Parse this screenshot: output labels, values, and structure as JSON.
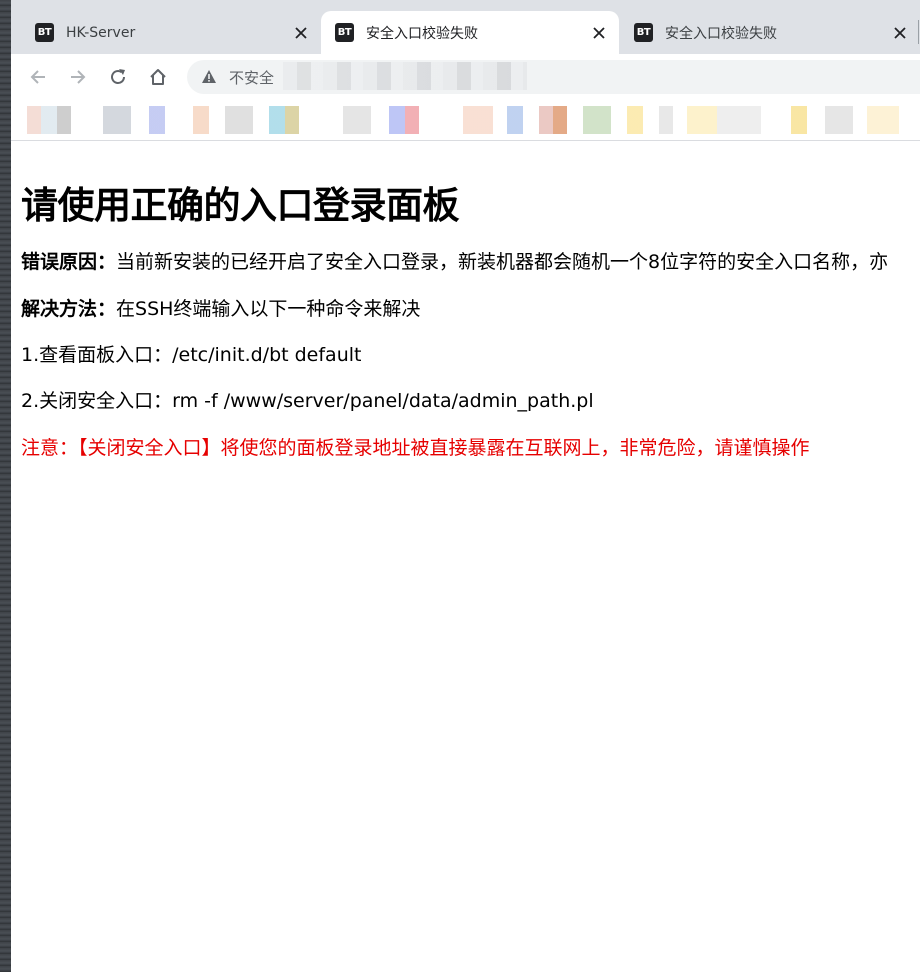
{
  "tabs": [
    {
      "favicon": "BT",
      "title": "HK-Server",
      "active": false
    },
    {
      "favicon": "BT",
      "title": "安全入口校验失败",
      "active": true
    },
    {
      "favicon": "BT",
      "title": "安全入口校验失败",
      "active": false
    }
  ],
  "toolbar": {
    "security_label": "不安全",
    "icons": [
      "back-icon",
      "forward-icon",
      "reload-icon",
      "home-icon",
      "warning-icon"
    ]
  },
  "page": {
    "heading": "请使用正确的入口登录面板",
    "reason_label": "错误原因：",
    "reason_text": "当前新安装的已经开启了安全入口登录，新装机器都会随机一个8位字符的安全入口名称，亦",
    "solution_label": "解决方法：",
    "solution_text": "在SSH终端输入以下一种命令来解决",
    "step1": "1.查看面板入口：/etc/init.d/bt default",
    "step2": "2.关闭安全入口：rm -f /www/server/panel/data/admin_path.pl",
    "warning": "注意：【关闭安全入口】将使您的面板登录地址被直接暴露在互联网上，非常危险，请谨慎操作"
  },
  "colors": {
    "warning_text": "#e60000",
    "tabstrip_bg": "#dee1e6",
    "omnibox_bg": "#f1f3f4"
  }
}
